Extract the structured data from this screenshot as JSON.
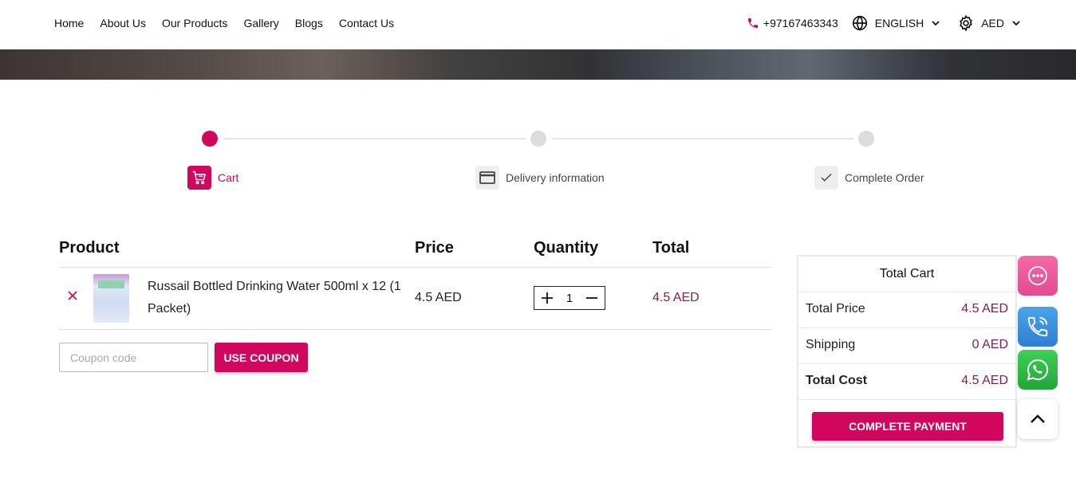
{
  "nav": {
    "home": "Home",
    "about": "About Us",
    "products": "Our Products",
    "gallery": "Gallery",
    "blogs": "Blogs",
    "contact": "Contact Us"
  },
  "header": {
    "phone": "+97167463343",
    "language": "ENGLISH",
    "currency": "AED"
  },
  "stepper": {
    "steps": [
      {
        "label": "Cart",
        "icon": "cart-icon",
        "active": true
      },
      {
        "label": "Delivery information",
        "icon": "card-icon",
        "active": false
      },
      {
        "label": "Complete Order",
        "icon": "check-icon",
        "active": false
      }
    ]
  },
  "cart_table": {
    "headers": {
      "product": "Product",
      "price": "Price",
      "quantity": "Quantity",
      "total": "Total"
    },
    "items": [
      {
        "name": "Russail Bottled Drinking Water 500ml x 12 (1 Packet)",
        "price": "4.5 AED",
        "quantity": "1",
        "total": "4.5 AED"
      }
    ]
  },
  "coupon": {
    "placeholder": "Coupon code",
    "button": "USE COUPON"
  },
  "totals": {
    "title": "Total Cart",
    "total_price_label": "Total Price",
    "total_price_value": "4.5 AED",
    "shipping_label": "Shipping",
    "shipping_value": "0 AED",
    "total_cost_label": "Total Cost",
    "total_cost_value": "4.5 AED",
    "pay_button": "COMPLETE PAYMENT"
  },
  "colors": {
    "accent": "#d1075f",
    "price_text": "#8a1c4c"
  }
}
